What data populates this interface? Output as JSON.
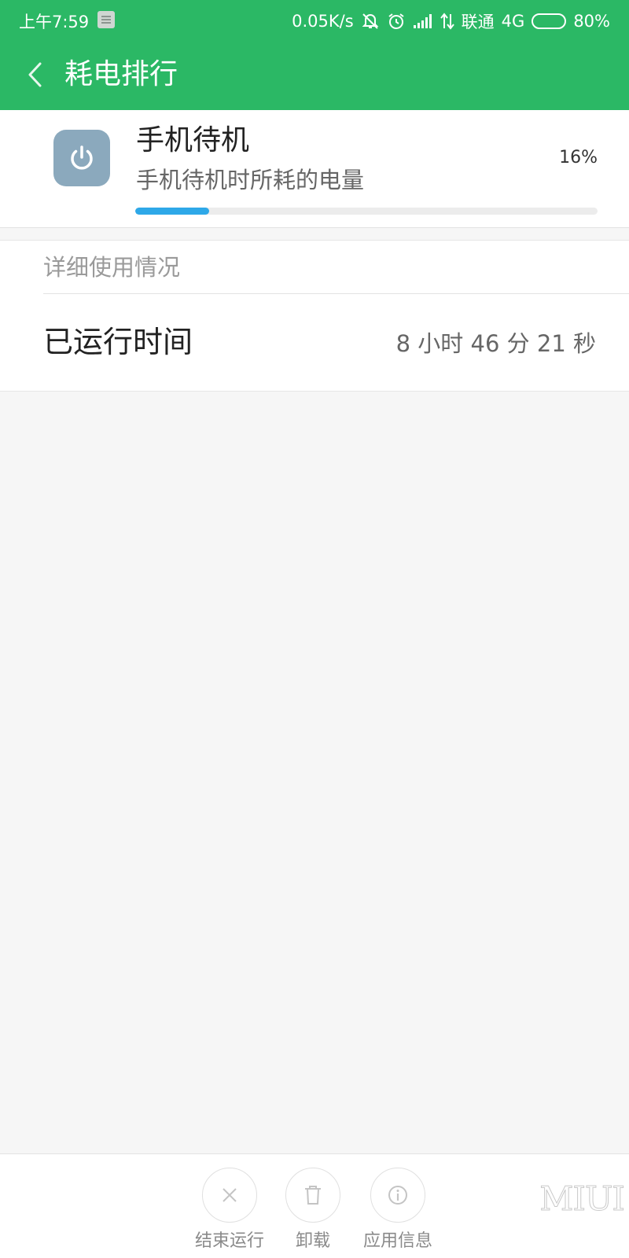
{
  "status_bar": {
    "time": "上午7:59",
    "net_speed": "0.05K/s",
    "carrier": "联通",
    "network_type": "4G",
    "battery_percent": "80%",
    "battery_level": 0.8,
    "icons": [
      "notification-icon",
      "silent-icon",
      "alarm-icon",
      "signal-icon",
      "data-arrows-icon",
      "battery-icon"
    ]
  },
  "action_bar": {
    "title": "耗电排行",
    "back_icon": "chevron-left-icon"
  },
  "summary": {
    "icon": "power-icon",
    "icon_color": "#8ba9bd",
    "name": "手机待机",
    "description": "手机待机时所耗的电量",
    "percent_text": "16%",
    "percent_value": 0.16
  },
  "detail": {
    "section_title": "详细使用情况",
    "run_time_label": "已运行时间",
    "run_time_value": "8 小时 46 分 21 秒"
  },
  "bottom_actions": [
    {
      "label": "结束运行",
      "icon": "close-icon"
    },
    {
      "label": "卸载",
      "icon": "trash-icon"
    },
    {
      "label": "应用信息",
      "icon": "info-icon"
    }
  ],
  "watermark": "MIUI",
  "colors": {
    "header": "#2bb865",
    "progress": "#2ea8e8",
    "background": "#f6f6f6"
  }
}
